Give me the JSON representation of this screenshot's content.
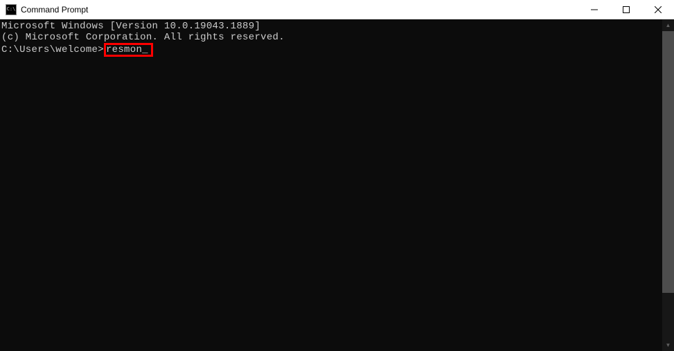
{
  "window": {
    "title": "Command Prompt",
    "icon_label": "C:\\"
  },
  "terminal": {
    "line1": "Microsoft Windows [Version 10.0.19043.1889]",
    "line2": "(c) Microsoft Corporation. All rights reserved.",
    "blank": "",
    "prompt": "C:\\Users\\welcome>",
    "command": "resmon",
    "cursor": "_"
  },
  "highlight": {
    "color": "#ff0000"
  }
}
